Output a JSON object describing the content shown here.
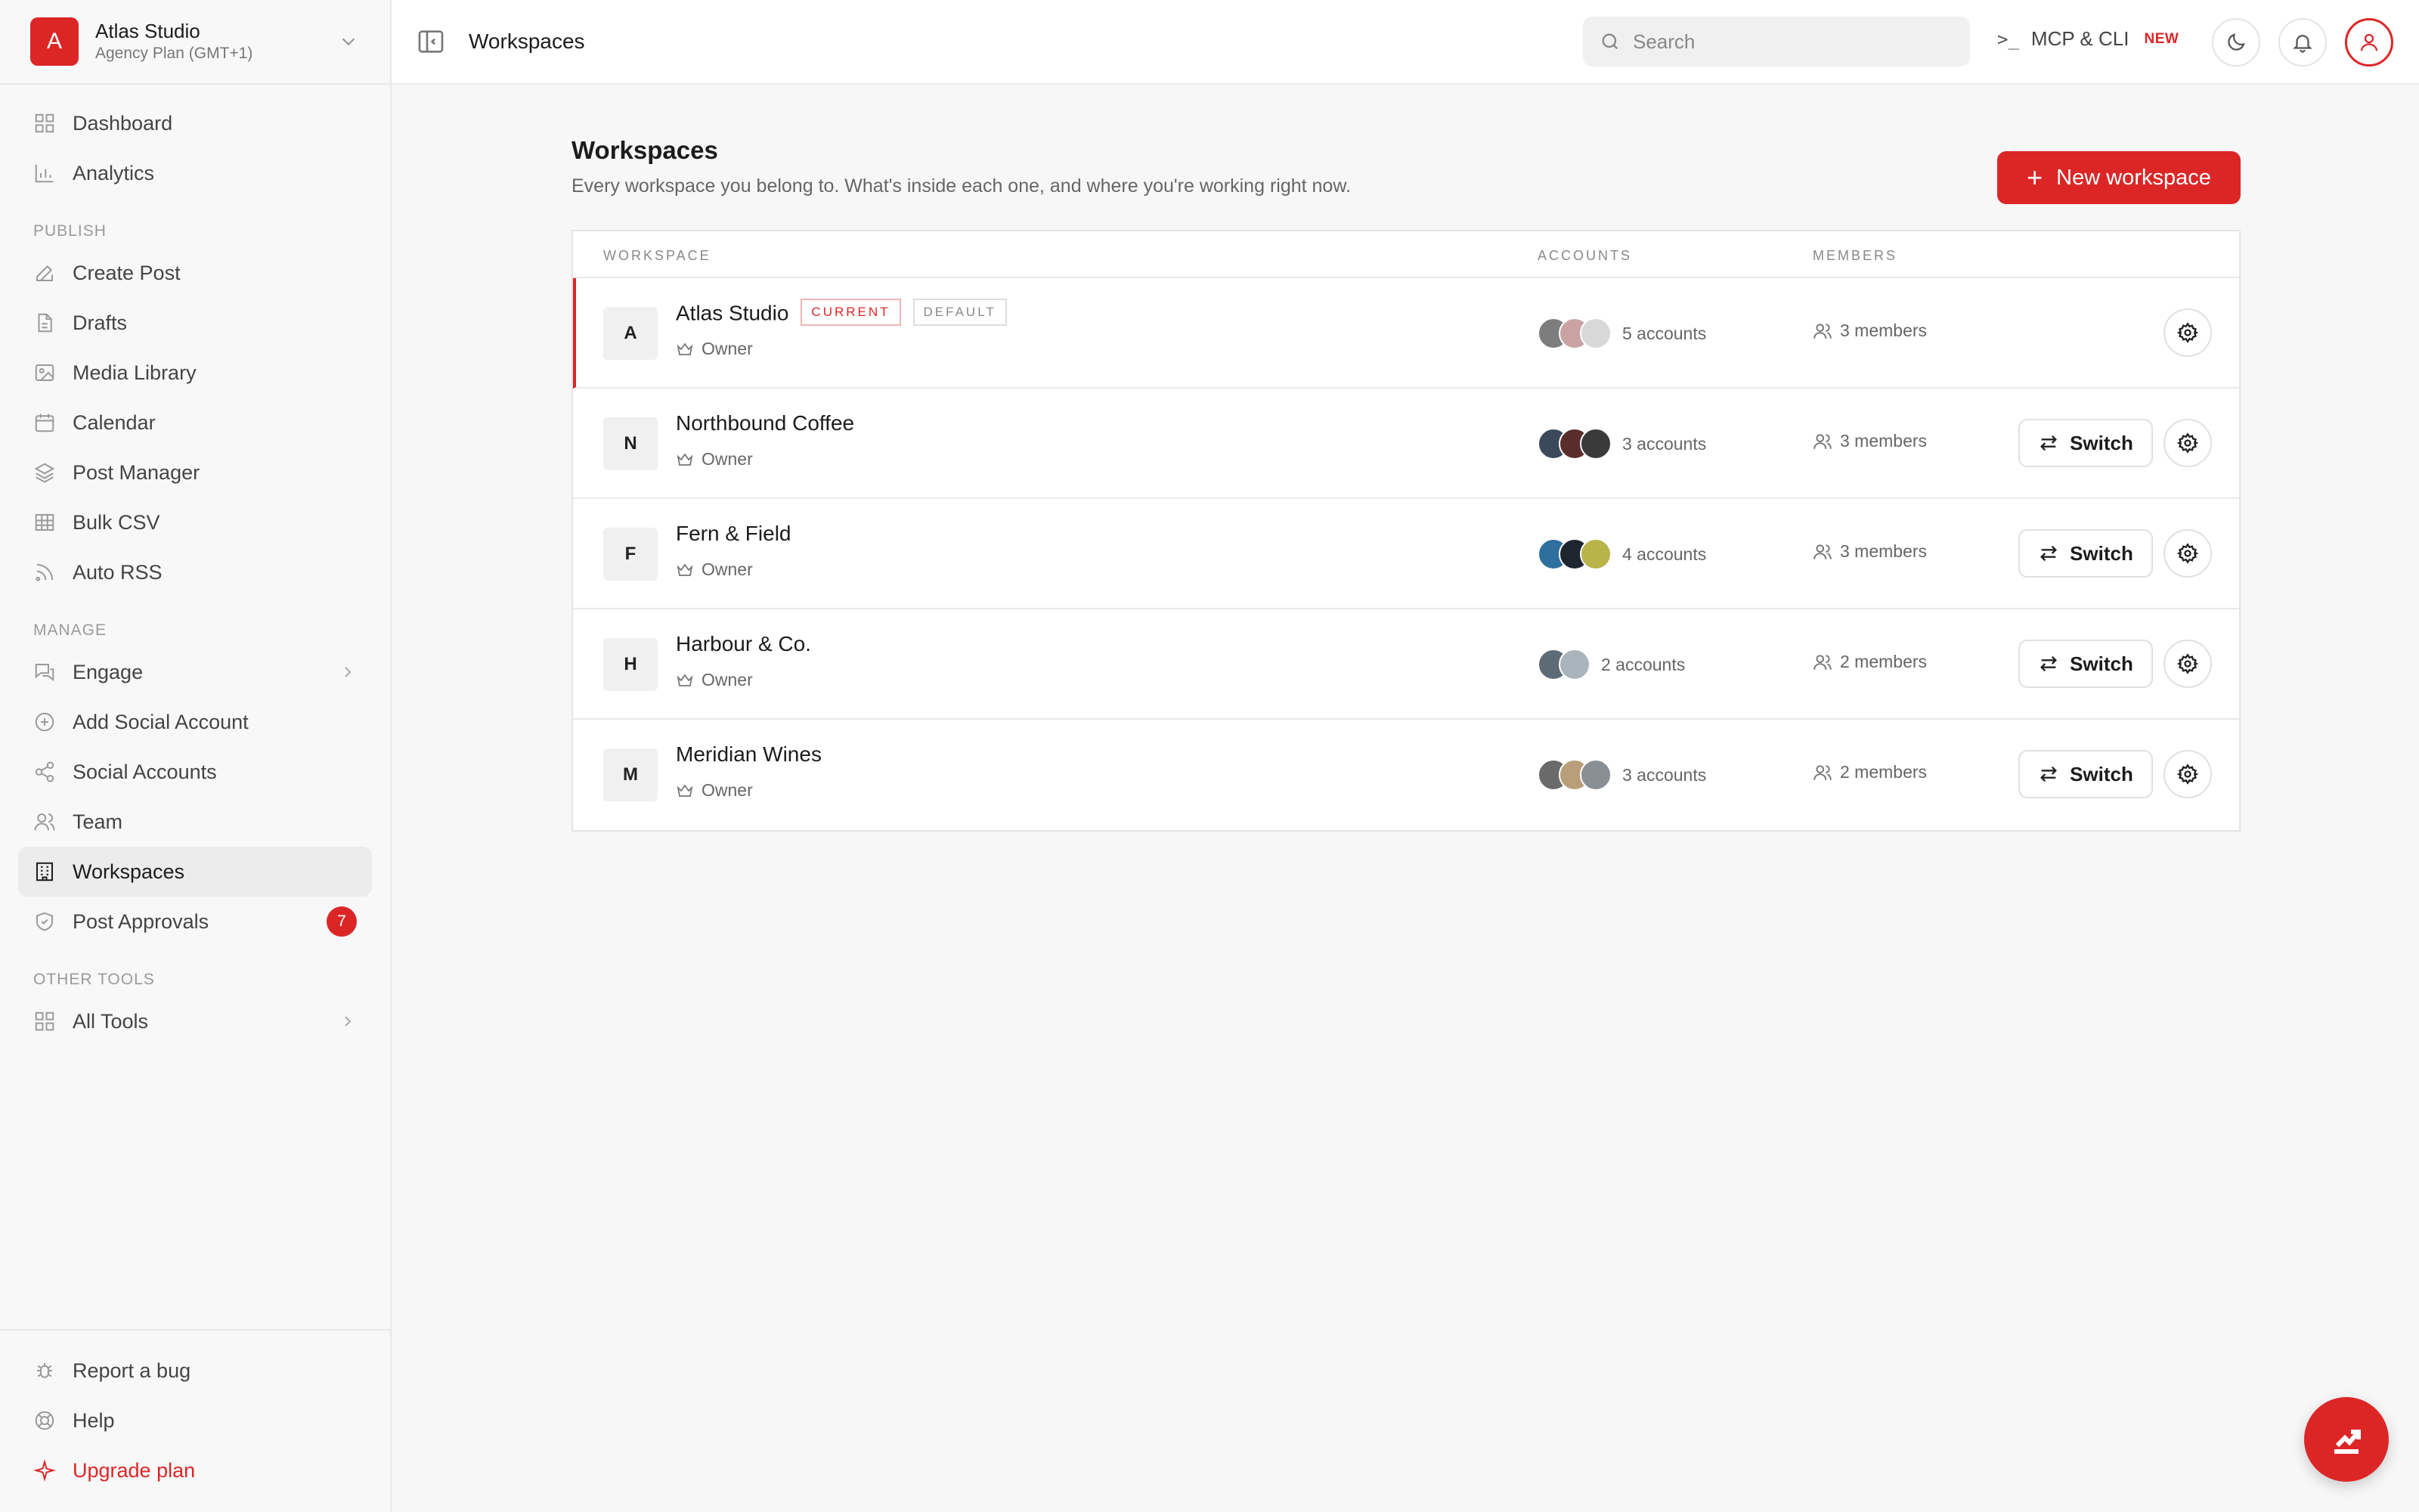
{
  "org": {
    "logo_letter": "A",
    "name": "Atlas Studio",
    "plan": "Agency Plan (GMT+1)"
  },
  "sidebar": {
    "top_items": [
      {
        "label": "Dashboard",
        "icon": "grid-icon"
      },
      {
        "label": "Analytics",
        "icon": "bar-chart-icon"
      }
    ],
    "publish_title": "PUBLISH",
    "publish_items": [
      {
        "label": "Create Post",
        "icon": "edit-icon"
      },
      {
        "label": "Drafts",
        "icon": "file-icon"
      },
      {
        "label": "Media Library",
        "icon": "image-icon"
      },
      {
        "label": "Calendar",
        "icon": "calendar-icon"
      },
      {
        "label": "Post Manager",
        "icon": "layers-icon"
      },
      {
        "label": "Bulk CSV",
        "icon": "table-icon"
      },
      {
        "label": "Auto RSS",
        "icon": "rss-icon"
      }
    ],
    "manage_title": "MANAGE",
    "manage_items": [
      {
        "label": "Engage",
        "icon": "chat-icon"
      },
      {
        "label": "Add Social Account",
        "icon": "plus-circle-icon"
      },
      {
        "label": "Social Accounts",
        "icon": "share-icon"
      },
      {
        "label": "Team",
        "icon": "users-icon"
      },
      {
        "label": "Workspaces",
        "icon": "building-icon"
      },
      {
        "label": "Post Approvals",
        "icon": "shield-icon",
        "badge": "7"
      }
    ],
    "other_title": "OTHER TOOLS",
    "other_items": [
      {
        "label": "All Tools",
        "icon": "grid-icon"
      }
    ],
    "bottom_items": [
      {
        "label": "Report a bug",
        "icon": "bug-icon"
      },
      {
        "label": "Help",
        "icon": "lifebuoy-icon"
      },
      {
        "label": "Upgrade plan",
        "icon": "sparkle-icon"
      }
    ]
  },
  "topbar": {
    "title": "Workspaces",
    "search_placeholder": "Search",
    "mcp_prompt": ">_",
    "mcp_label": "MCP & CLI",
    "mcp_badge": "NEW"
  },
  "main": {
    "title": "Workspaces",
    "subtitle": "Every workspace you belong to. What's inside each one, and where you're working right now.",
    "new_button_label": "New workspace",
    "columns": {
      "workspace": "WORKSPACE",
      "accounts": "ACCOUNTS",
      "members": "MEMBERS"
    },
    "switch_label": "Switch",
    "tag_current": "CURRENT",
    "tag_default": "DEFAULT",
    "rows": [
      {
        "letter": "A",
        "name": "Atlas Studio",
        "role": "Owner",
        "accounts": "5 accounts",
        "members": "3 members",
        "current": true,
        "dots": [
          "#7d7d7d",
          "#c9a3a3",
          "#d8d8d8"
        ]
      },
      {
        "letter": "N",
        "name": "Northbound Coffee",
        "role": "Owner",
        "accounts": "3 accounts",
        "members": "3 members",
        "current": false,
        "dots": [
          "#3b4a5a",
          "#5a2d2d",
          "#3a3a3a"
        ]
      },
      {
        "letter": "F",
        "name": "Fern & Field",
        "role": "Owner",
        "accounts": "4 accounts",
        "members": "3 members",
        "current": false,
        "dots": [
          "#2f6f9e",
          "#1e2630",
          "#b8b44a"
        ]
      },
      {
        "letter": "H",
        "name": "Harbour & Co.",
        "role": "Owner",
        "accounts": "2 accounts",
        "members": "2 members",
        "current": false,
        "dots": [
          "#5d6b76",
          "#aab4bd"
        ]
      },
      {
        "letter": "M",
        "name": "Meridian Wines",
        "role": "Owner",
        "accounts": "3 accounts",
        "members": "2 members",
        "current": false,
        "dots": [
          "#6a6a6a",
          "#b89f7a",
          "#8a8f94"
        ]
      }
    ]
  },
  "colors": {
    "accent": "#dc2626"
  }
}
